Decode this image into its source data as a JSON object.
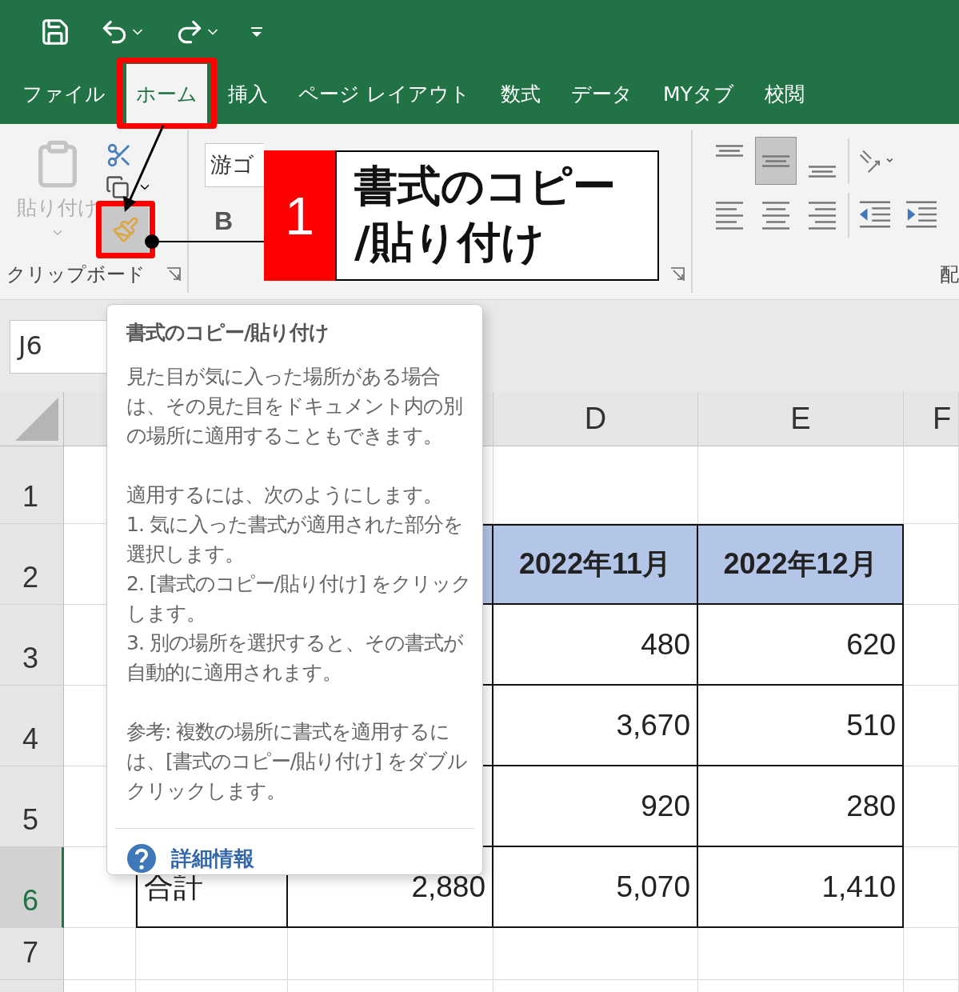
{
  "tabs": [
    {
      "label": "ファイル",
      "selected": false
    },
    {
      "label": "ホーム",
      "selected": true
    },
    {
      "label": "挿入",
      "selected": false
    },
    {
      "label": "ページ レイアウト",
      "selected": false
    },
    {
      "label": "数式",
      "selected": false
    },
    {
      "label": "データ",
      "selected": false
    },
    {
      "label": "MYタブ",
      "selected": false
    },
    {
      "label": "校閲",
      "selected": false
    }
  ],
  "ribbon": {
    "clipboard": {
      "label": "クリップボード",
      "paste": {
        "label": "貼り付け",
        "disabled": true
      }
    },
    "font": {
      "font_name": "游ゴ",
      "bold": "B"
    },
    "alignment": {
      "label": "配",
      "vertical_align": [
        {
          "kind": "top",
          "selected": false
        },
        {
          "kind": "middle",
          "selected": true
        },
        {
          "kind": "bottom",
          "selected": false
        }
      ]
    }
  },
  "callout": {
    "number": "1",
    "text": "書式のコピー\n/貼り付け"
  },
  "name_box": "J6",
  "column_headers": [
    "D",
    "E",
    "F"
  ],
  "rows": [
    {
      "header": "1",
      "selected": false,
      "kind": "empty"
    },
    {
      "header": "2",
      "selected": false,
      "kind": "header",
      "cells": [
        "2022年11月",
        "2022年12月"
      ]
    },
    {
      "header": "3",
      "selected": false,
      "kind": "data",
      "cells": [
        "480",
        "620"
      ]
    },
    {
      "header": "4",
      "selected": false,
      "kind": "data",
      "cells": [
        "3,670",
        "510"
      ]
    },
    {
      "header": "5",
      "selected": false,
      "kind": "data",
      "cells": [
        "920",
        "280"
      ]
    },
    {
      "header": "6",
      "selected": true,
      "kind": "total",
      "cells": [
        "合計",
        "2,880",
        "5,070",
        "1,410"
      ]
    },
    {
      "header": "7",
      "selected": false,
      "kind": "empty"
    }
  ],
  "tooltip": {
    "title": "書式のコピー/貼り付け",
    "intro": "見た目が気に入った場所がある場合は、その見た目をドキュメント内の別の場所に適用することもできます。",
    "lead": "適用するには、次のようにします。",
    "steps": [
      "1. 気に入った書式が適用された部分を選択します。",
      "2. [書式のコピー/貼り付け] をクリックします。",
      "3. 別の場所を選択すると、その書式が自動的に適用されます。"
    ],
    "note": "参考: 複数の場所に書式を適用するには、[書式のコピー/貼り付け] をダブルクリックします。",
    "link": "詳細情報"
  }
}
